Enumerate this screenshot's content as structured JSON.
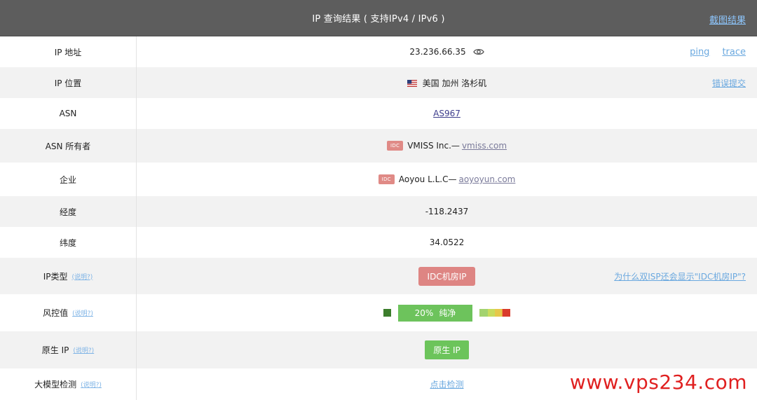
{
  "header": {
    "title": "IP 查询结果 ( 支持IPv4 / IPv6 )",
    "screenshot_label": "截图结果"
  },
  "rows": {
    "ip": {
      "label": "IP 地址",
      "value": "23.236.66.35",
      "ping": "ping",
      "trace": "trace"
    },
    "location": {
      "label": "IP 位置",
      "value": "美国 加州 洛杉矶",
      "error_report": "错误提交"
    },
    "asn": {
      "label": "ASN",
      "value": "AS967"
    },
    "asn_owner": {
      "label": "ASN 所有者",
      "badge": "IDC",
      "name": "VMISS Inc.—",
      "domain": "vmiss.com"
    },
    "company": {
      "label": "企业",
      "badge": "IDC",
      "name": "Aoyou L.L.C—",
      "domain": "aoyoyun.com"
    },
    "longitude": {
      "label": "经度",
      "value": "-118.2437"
    },
    "latitude": {
      "label": "纬度",
      "value": "34.0522"
    },
    "ip_type": {
      "label": "IP类型",
      "help": "(说明?)",
      "value": "IDC机房IP",
      "question": "为什么双ISP还会显示\"IDC机房IP\"?"
    },
    "risk": {
      "label": "风控值",
      "help": "(说明?)",
      "percent_label": "20%",
      "status": "纯净",
      "value_percent": 20
    },
    "native": {
      "label": "原生 IP",
      "help": "(说明?)",
      "value": "原生 IP"
    },
    "llm": {
      "label": "大模型检测",
      "help": "(说明?)",
      "value": "点击检测"
    }
  },
  "colors": {
    "header_bg": "#5d5d5d",
    "link_blue": "#6aa8df",
    "idc_red": "#de8583",
    "native_green": "#6cc45b",
    "risk_dark_green": "#3c7d2c",
    "risk_scale": [
      "#a3d36f",
      "#c9dc5d",
      "#e6c84a",
      "#ee9a3a",
      "#d93b2b"
    ],
    "watermark_red": "#e02020"
  },
  "watermark": "www.vps234.com"
}
